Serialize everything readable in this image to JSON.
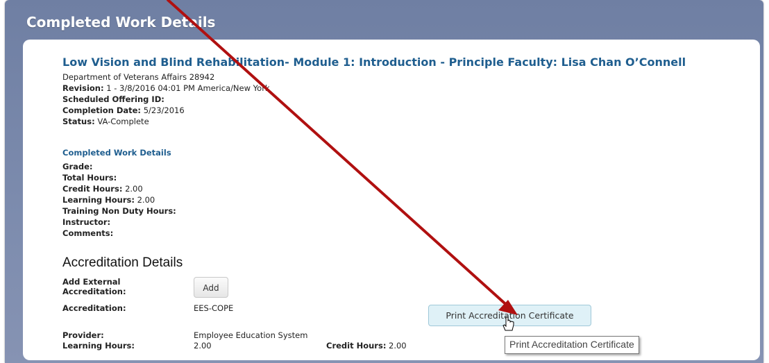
{
  "panel": {
    "title": "Completed Work Details"
  },
  "course": {
    "title": "Low Vision and Blind Rehabilitation- Module 1: Introduction - Principle Faculty: Lisa Chan O’Connell",
    "department": "Department of Veterans Affairs 28942",
    "revision_label": "Revision:",
    "revision_value": "1 - 3/8/2016 04:01 PM America/New York",
    "scheduled_offering_label": "Scheduled Offering ID:",
    "completion_date_label": "Completion Date:",
    "completion_date_value": "5/23/2016",
    "status_label": "Status:",
    "status_value": "VA-Complete"
  },
  "work_details": {
    "heading": "Completed Work Details",
    "grade_label": "Grade:",
    "total_hours_label": "Total Hours:",
    "credit_hours_label": "Credit Hours:",
    "credit_hours_value": "2.00",
    "learning_hours_label": "Learning Hours:",
    "learning_hours_value": "2.00",
    "training_non_duty_label": "Training Non Duty Hours:",
    "instructor_label": "Instructor:",
    "comments_label": "Comments:"
  },
  "accreditation": {
    "heading": "Accreditation Details",
    "add_external_label": "Add External Accreditation:",
    "add_button": "Add",
    "accreditation_label": "Accreditation:",
    "accreditation_value": "EES-COPE",
    "print_button": "Print Accreditation Certificate",
    "provider_label": "Provider:",
    "provider_value": "Employee Education System",
    "learning_hours_label": "Learning Hours:",
    "learning_hours_value": "2.00",
    "credit_hours_label": "Credit Hours:",
    "credit_hours_value": "2.00"
  },
  "tooltip": {
    "text": "Print Accreditation Certificate"
  },
  "annotation": {
    "arrow_color": "#b01010"
  }
}
